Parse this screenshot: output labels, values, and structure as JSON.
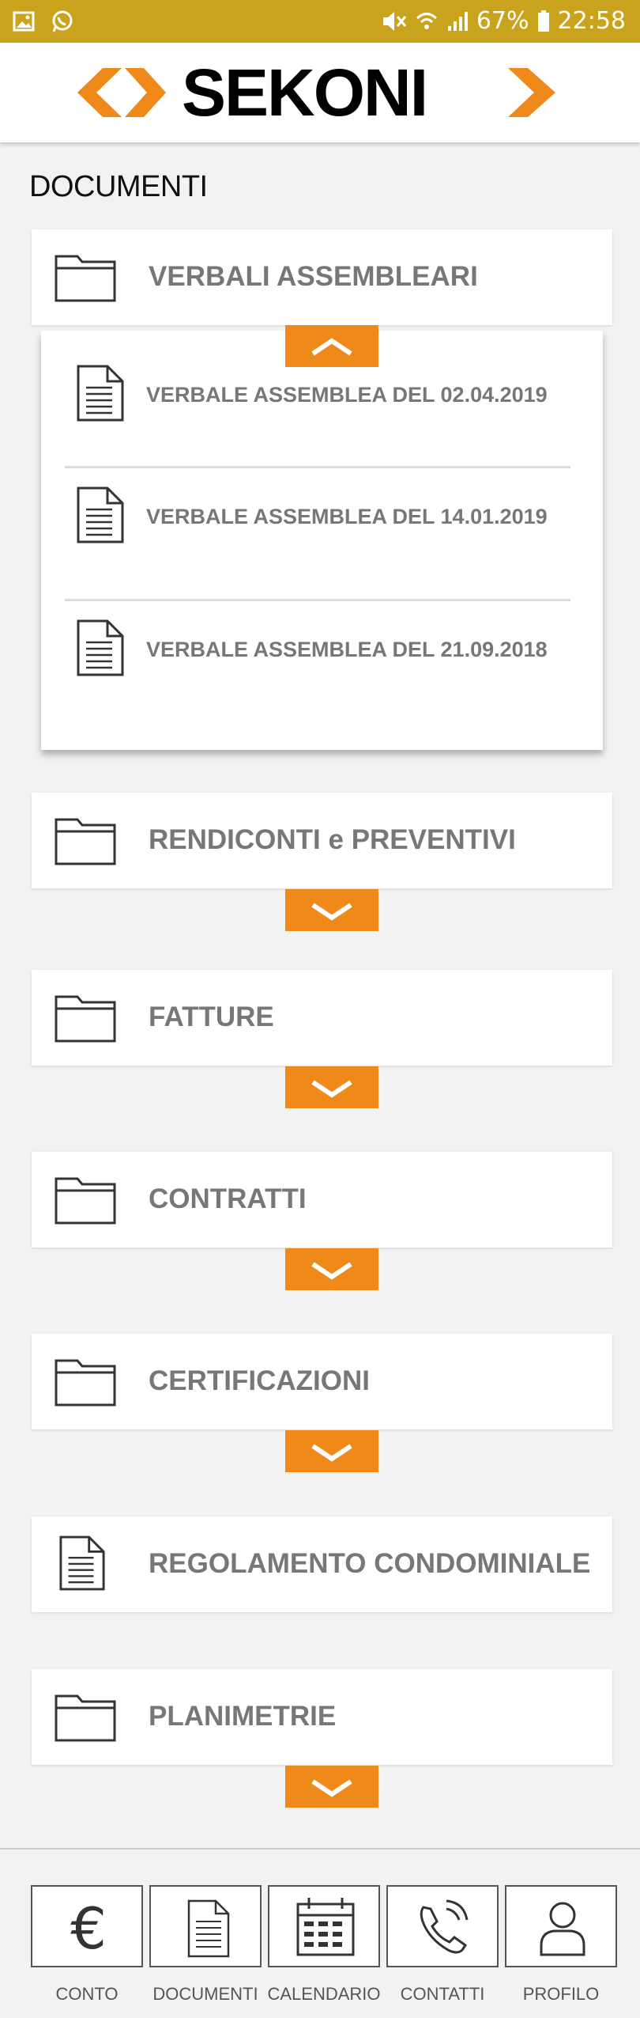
{
  "status_bar": {
    "battery": "67%",
    "time": "22:58",
    "icons": [
      "image-icon",
      "whatsapp-icon",
      "mute-icon",
      "wifi-icon",
      "signal-icon",
      "battery-icon"
    ]
  },
  "brand": {
    "name": "SEKONI",
    "accent": "#ef8a1a"
  },
  "page": {
    "title": "DOCUMENTI"
  },
  "sections": [
    {
      "label": "VERBALI ASSEMBLEARI",
      "icon": "folder-icon",
      "expanded": true
    },
    {
      "label": "RENDICONTI e PREVENTIVI",
      "icon": "folder-icon",
      "expanded": false
    },
    {
      "label": "FATTURE",
      "icon": "folder-icon",
      "expanded": false
    },
    {
      "label": "CONTRATTI",
      "icon": "folder-icon",
      "expanded": false
    },
    {
      "label": "CERTIFICAZIONI",
      "icon": "folder-icon",
      "expanded": false
    },
    {
      "label": "REGOLAMENTO CONDOMINIALE",
      "icon": "document-icon",
      "expanded": false
    },
    {
      "label": "PLANIMETRIE",
      "icon": "folder-icon",
      "expanded": false
    }
  ],
  "verbali_items": [
    {
      "label": "VERBALE ASSEMBLEA DEL 02.04.2019"
    },
    {
      "label": "VERBALE ASSEMBLEA DEL 14.01.2019"
    },
    {
      "label": "VERBALE ASSEMBLEA DEL 21.09.2018"
    }
  ],
  "bottom_nav": [
    {
      "label": "CONTO",
      "icon": "euro-icon"
    },
    {
      "label": "DOCUMENTI",
      "icon": "document-icon"
    },
    {
      "label": "CALENDARIO",
      "icon": "calendar-icon"
    },
    {
      "label": "CONTATTI",
      "icon": "phone-icon"
    },
    {
      "label": "PROFILO",
      "icon": "user-icon"
    }
  ]
}
